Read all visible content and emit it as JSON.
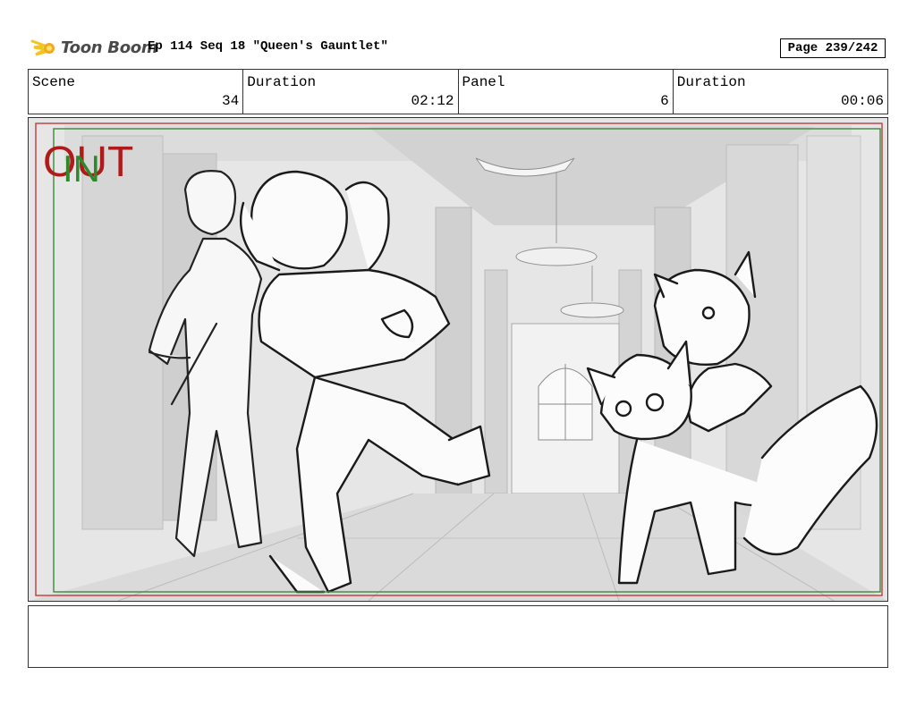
{
  "header": {
    "logo_text": "Toon Boom",
    "title": "Ep 114 Seq 18 \"Queen's Gauntlet\"",
    "page": "Page 239/242"
  },
  "info": [
    {
      "label": "Scene",
      "value": "34"
    },
    {
      "label": "Duration",
      "value": "02:12"
    },
    {
      "label": "Panel",
      "value": "6"
    },
    {
      "label": "Duration",
      "value": "00:06"
    }
  ],
  "frame": {
    "out_label": "OUT",
    "in_label": "IN",
    "out_color": "#b01a1a",
    "in_color": "#2c8a2c"
  },
  "notes": ""
}
